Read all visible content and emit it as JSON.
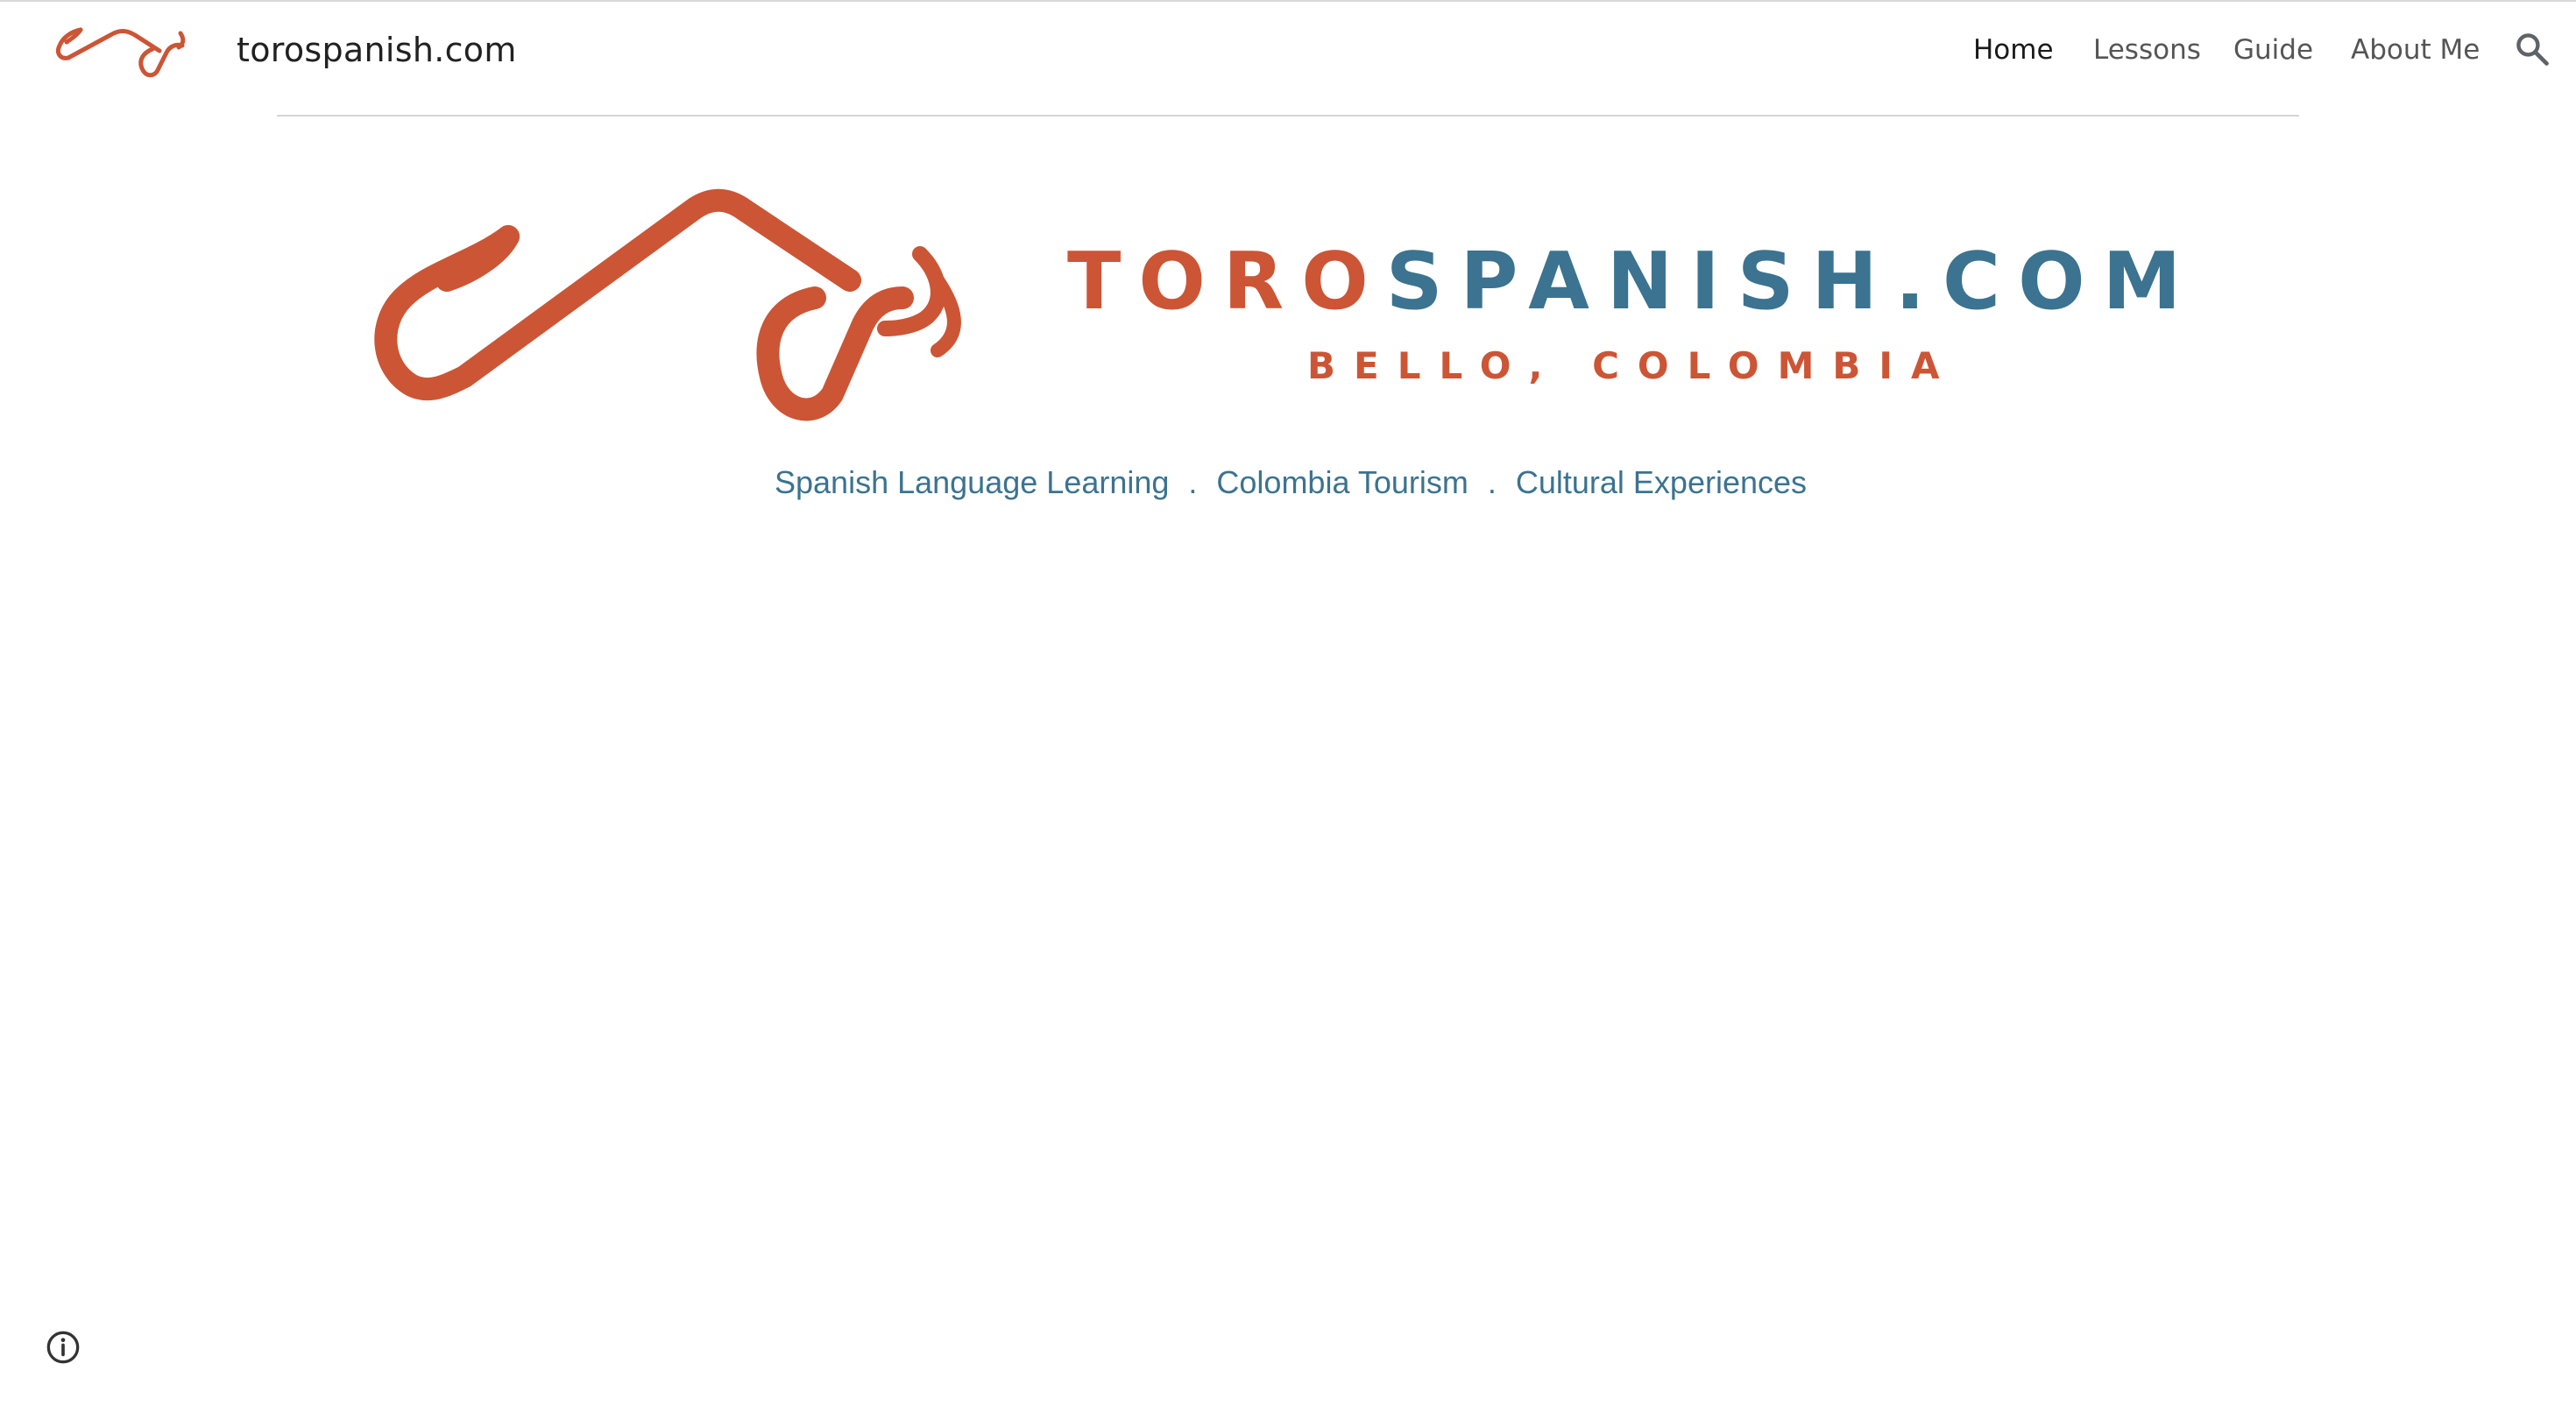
{
  "header": {
    "site_title": "torospanish.com",
    "logo_icon": "bull-logo-icon",
    "nav": [
      {
        "label": "Home",
        "active": true
      },
      {
        "label": "Lessons",
        "active": false
      },
      {
        "label": "Guide",
        "active": false
      },
      {
        "label": "About Me",
        "active": false
      }
    ],
    "search_icon": "search-icon"
  },
  "banner": {
    "title_part1": "TORO",
    "title_part2": "SPANISH.COM",
    "subtitle": "BELLO, COLOMBIA",
    "tagline": [
      "Spanish Language Learning",
      "Colombia Tourism",
      "Cultural Experiences"
    ],
    "tagline_separator": "."
  },
  "footer": {
    "info_icon": "info-icon"
  },
  "colors": {
    "brand_orange": "#cc5535",
    "brand_blue": "#3b7390",
    "nav_active": "#1a1a1a",
    "nav_inactive": "#555555"
  }
}
